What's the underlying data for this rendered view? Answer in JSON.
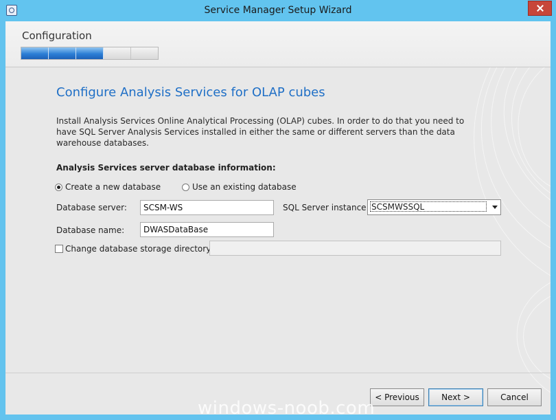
{
  "window": {
    "title": "Service Manager Setup Wizard"
  },
  "header": {
    "stage_title": "Configuration",
    "progress": {
      "completed_steps": 3,
      "total_steps": 5
    }
  },
  "content": {
    "heading": "Configure Analysis Services for OLAP cubes",
    "description": "Install Analysis Services Online Analytical Processing (OLAP) cubes. In order to do that you need to have SQL Server Analysis Services installed in either the same or different servers than the data warehouse databases.",
    "section_title": "Analysis Services server database information:",
    "radios": {
      "create_label": "Create a new database",
      "existing_label": "Use an existing database",
      "selected": "create"
    },
    "database_server": {
      "label": "Database server:",
      "value": "SCSM-WS"
    },
    "sql_instance": {
      "label": "SQL Server instance:",
      "value": "SCSMWSSQL"
    },
    "database_name": {
      "label": "Database name:",
      "value": "DWASDataBase"
    },
    "storage_dir": {
      "label": "Change database storage directory:",
      "checked": false,
      "value": ""
    }
  },
  "footer": {
    "previous_label": "< Previous",
    "next_label": "Next >",
    "cancel_label": "Cancel"
  },
  "watermark": "windows-noob.com",
  "colors": {
    "titlebar": "#62c4ef",
    "heading": "#1f6fc6",
    "progress_fill": "#2d7fd6",
    "close_button": "#c7463a"
  }
}
